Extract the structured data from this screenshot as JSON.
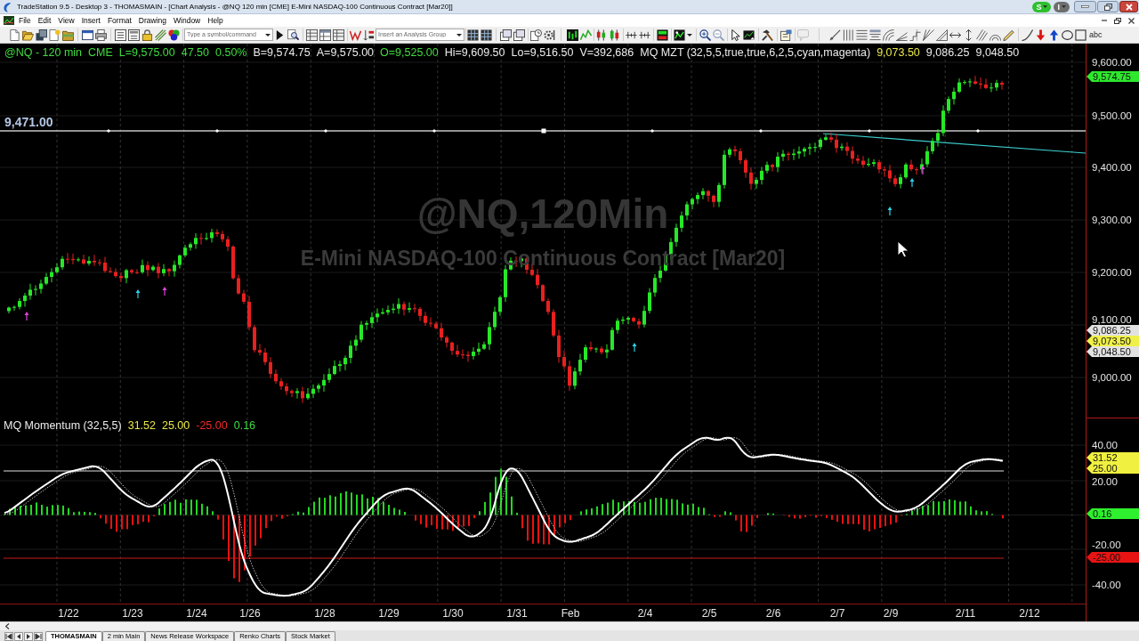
{
  "window": {
    "title": "TradeStation 9.5 - Desktop 3 - THOMASMAIN - [Chart Analysis - @NQ 120 min [CME] E-Mini NASDAQ-100 Continuous Contract [Mar20]]",
    "status_badges": [
      {
        "label": "S",
        "color": "#2fbf2f"
      },
      {
        "label": "I",
        "color": "#6e6e6e"
      }
    ]
  },
  "menu": [
    "File",
    "Edit",
    "View",
    "Insert",
    "Format",
    "Drawing",
    "Window",
    "Help"
  ],
  "toolbar": {
    "symbol_field": {
      "placeholder": "Type a symbol/command"
    },
    "analysis_group_field": {
      "placeholder": "Insert an Analysis Group"
    },
    "text_tool": "abc"
  },
  "chart": {
    "header_values": [
      {
        "text": "@NQ - 120 min",
        "color": "#3fdc3f"
      },
      {
        "text": "CME",
        "color": "#3fdc3f"
      },
      {
        "text": "L=9,575.00",
        "color": "#3fdc3f"
      },
      {
        "text": "47.50",
        "color": "#3fdc3f"
      },
      {
        "text": "0.50%",
        "color": "#3fdc3f"
      },
      {
        "text": "B=9,574.75",
        "color": "#ececec"
      },
      {
        "text": "A=9,575.00",
        "color": "#ececec"
      },
      {
        "text": "O=9,525.00",
        "color": "#3fdc3f"
      },
      {
        "text": "Hi=9,609.50",
        "color": "#ececec"
      },
      {
        "text": "Lo=9,516.50",
        "color": "#ececec"
      },
      {
        "text": "V=392,686",
        "color": "#ececec"
      },
      {
        "text": "MQ MZT (32,5,5,true,true,6,2,5,cyan,magenta)",
        "color": "#ececec"
      },
      {
        "text": "9,073.50",
        "color": "#e8e84a"
      },
      {
        "text": "9,086.25",
        "color": "#ececec"
      },
      {
        "text": "9,048.50",
        "color": "#ececec"
      }
    ],
    "watermark": {
      "symbol": "@NQ,120Min",
      "description": "E-Mini NASDAQ-100 Continuous Contract [Mar20]"
    },
    "line_label": "9,471.00",
    "price_axis": [
      "9,600.00",
      "9,500.00",
      "9,400.00",
      "9,300.00",
      "9,200.00",
      "9,100.00",
      "9,000.00"
    ],
    "price_flags": [
      {
        "text": "9,574.75",
        "color": "#2ee82e"
      },
      {
        "text": "9,086.25",
        "color": "#e2e2e2"
      },
      {
        "text": "9,073.50",
        "color": "#f0f04a"
      },
      {
        "text": "9,048.50",
        "color": "#e2e2e2"
      }
    ],
    "indicator": {
      "header_values": [
        {
          "text": "MQ Momentum (32,5,5)",
          "color": "#ececec"
        },
        {
          "text": "31.52",
          "color": "#e8e84a"
        },
        {
          "text": "25.00",
          "color": "#e8e84a"
        },
        {
          "text": "-25.00",
          "color": "#f02a2a"
        },
        {
          "text": "0.16",
          "color": "#3fdc3f"
        }
      ],
      "axis": [
        "40.00",
        "20.00",
        "-20.00",
        "-40.00"
      ],
      "flags": [
        {
          "text": "31.52",
          "color": "#f0f040"
        },
        {
          "text": "25.00",
          "color": "#f0f040"
        },
        {
          "text": "0.16",
          "color": "#2ef02e"
        },
        {
          "text": "-25.00",
          "color": "#e81414"
        }
      ]
    },
    "date_axis": [
      "1/22",
      "1/23",
      "1/24",
      "1/26",
      "1/28",
      "1/29",
      "1/30",
      "1/31",
      "Feb",
      "2/4",
      "2/5",
      "2/6",
      "2/7",
      "2/9",
      "2/11",
      "2/12"
    ]
  },
  "workspace_tabs": [
    {
      "label": "THOMASMAIN",
      "selected": true
    },
    {
      "label": "2 min Main",
      "selected": false
    },
    {
      "label": "News Release Workspace",
      "selected": false
    },
    {
      "label": "Renko Charts",
      "selected": false
    },
    {
      "label": "Stock Market",
      "selected": false
    }
  ]
}
